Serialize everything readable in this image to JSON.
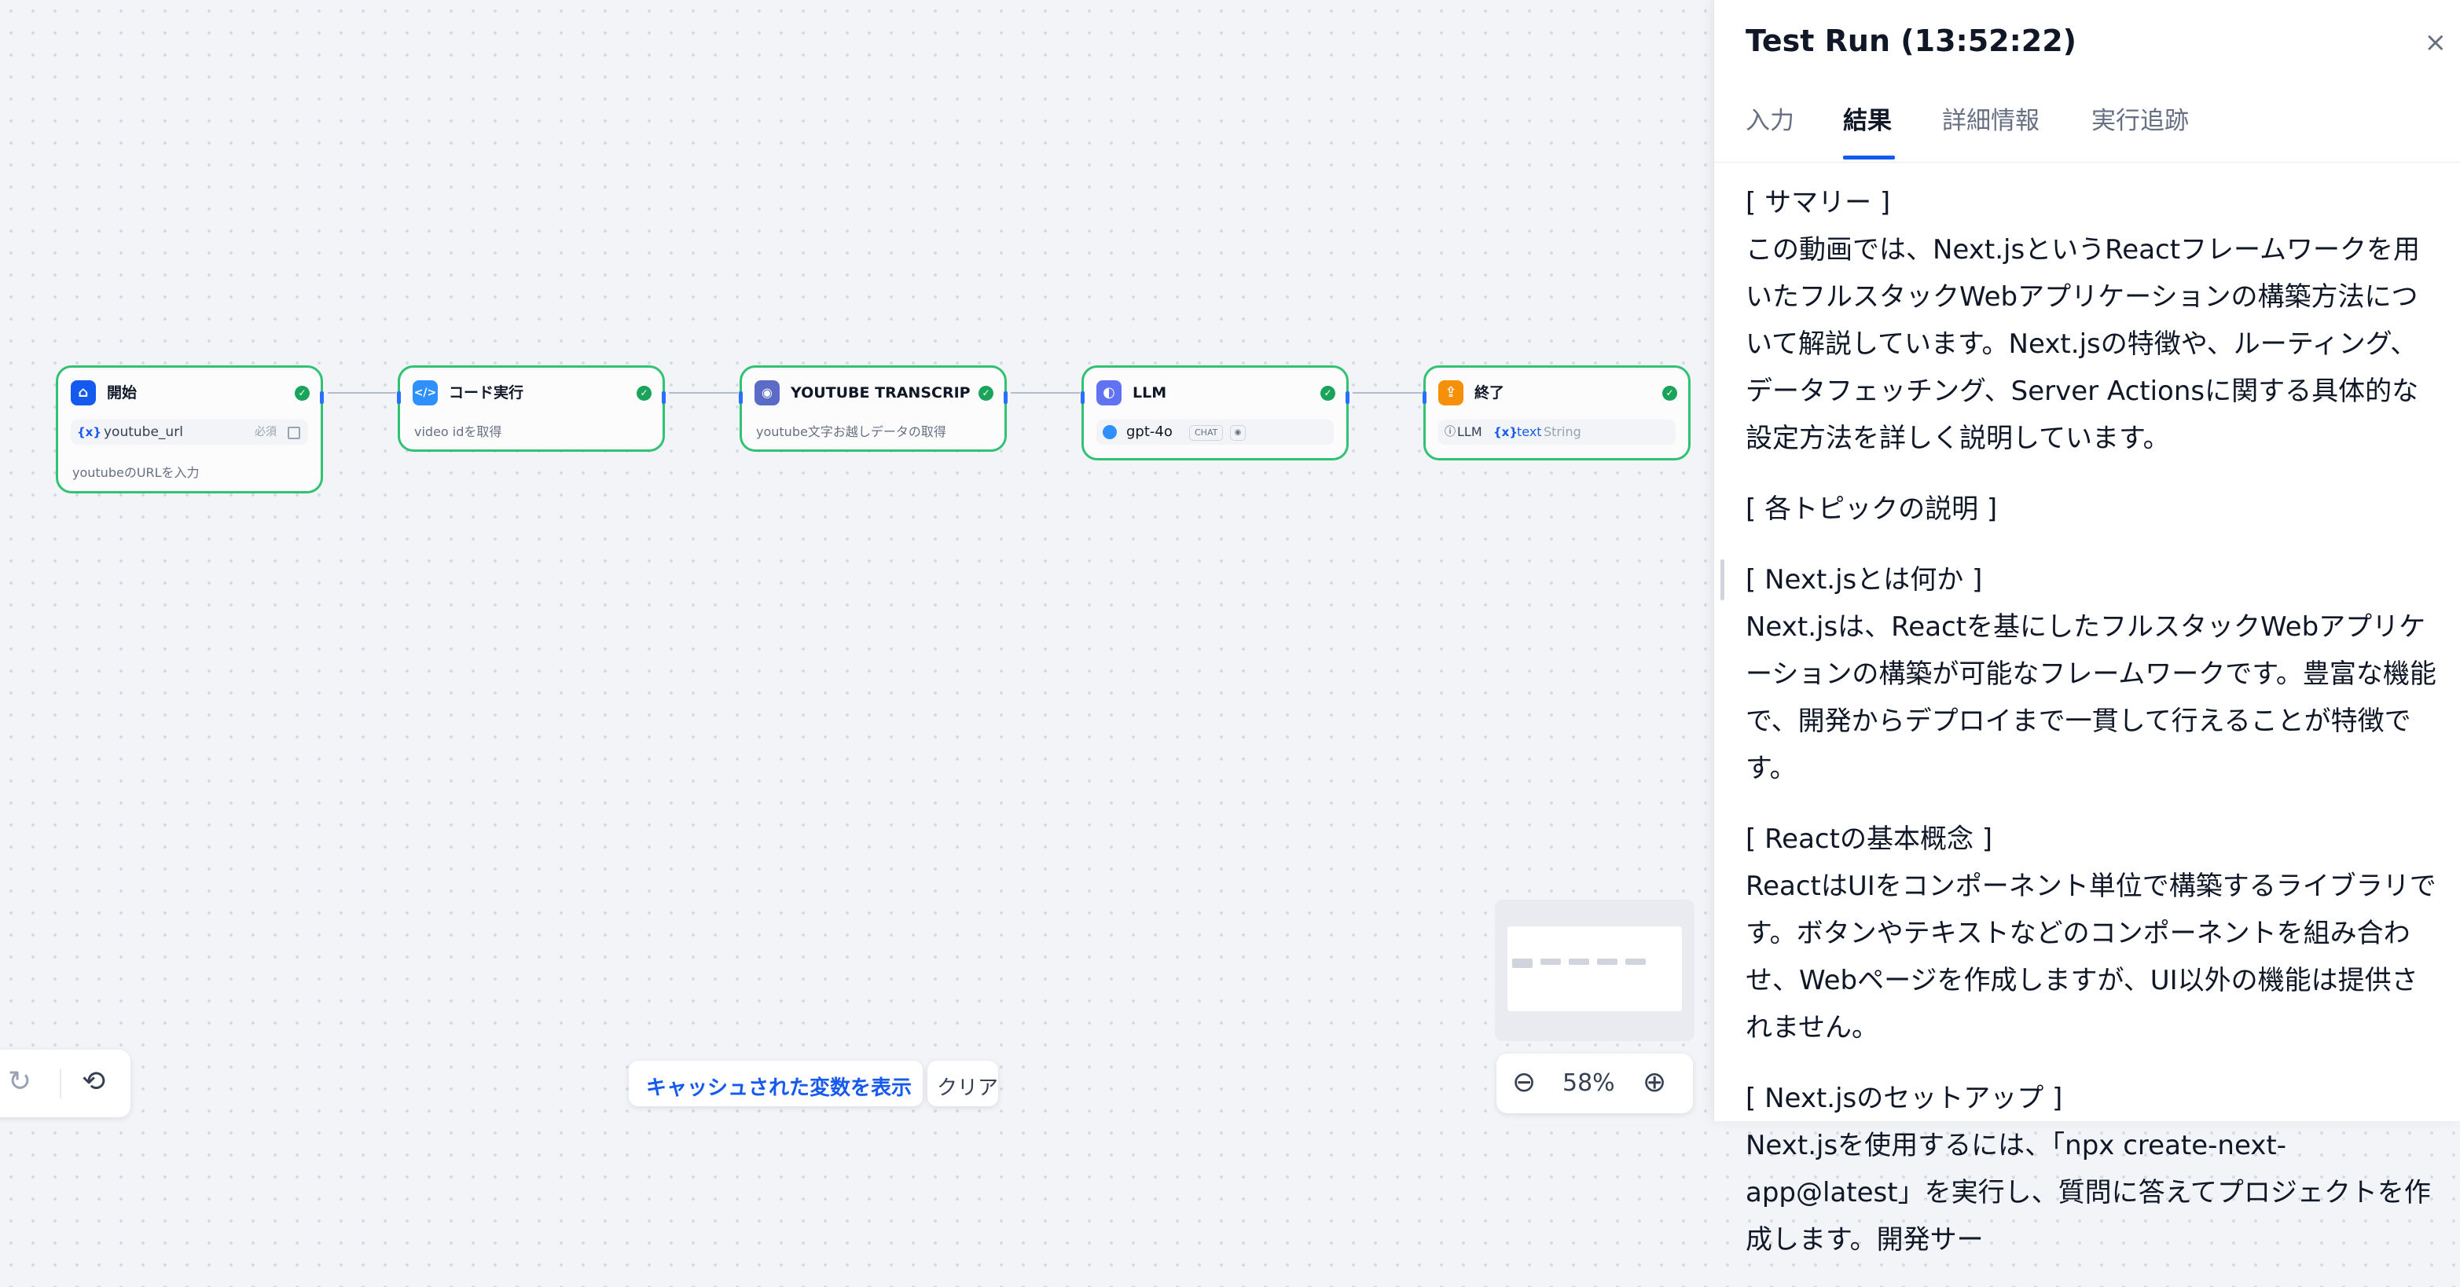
{
  "workflow": {
    "nodes": [
      {
        "title": "開始",
        "icon": "home-icon",
        "variable": "youtube_url",
        "required": "必須",
        "description": "youtubeのURLを入力"
      },
      {
        "title": "コード実行",
        "icon": "code-icon",
        "description": "video idを取得"
      },
      {
        "title": "YOUTUBE TRANSCRIPTS API",
        "icon": "plugin-icon",
        "description": "youtube文字お越しデータの取得"
      },
      {
        "title": "LLM",
        "icon": "brain-icon",
        "model": "gpt-4o",
        "model_mode": "CHAT"
      },
      {
        "title": "終了",
        "icon": "output-icon",
        "output_source": "LLM",
        "output_var": "text",
        "output_type": "String"
      }
    ]
  },
  "canvas_toolbar": {
    "show_cached_label": "キャッシュされた変数を表示",
    "clear_label": "クリア",
    "zoom": "58%"
  },
  "panel": {
    "title": "Test Run (13:52:22)",
    "close": "×",
    "tabs": [
      "入力",
      "結果",
      "詳細情報",
      "実行追跡"
    ],
    "active_tab": "結果",
    "result": {
      "summary_heading": "[ サマリー ]",
      "summary_text": "この動画では、Next.jsというReactフレームワークを用いたフルスタックWebアプリケーションの構築方法について解説しています。Next.jsの特徴や、ルーティング、データフェッチング、Server Actionsに関する具体的な設定方法を詳しく説明しています。",
      "topics_heading": "[ 各トピックの説明 ]",
      "t1_heading": "[ Next.jsとは何か ]",
      "t1_text": "Next.jsは、Reactを基にしたフルスタックWebアプリケーションの構築が可能なフレームワークです。豊富な機能で、開発からデプロイまで一貫して行えることが特徴です。",
      "t2_heading": "[ Reactの基本概念 ]",
      "t2_text": "ReactはUIをコンポーネント単位で構築するライブラリです。ボタンやテキストなどのコンポーネントを組み合わせ、Webページを作成しますが、UI以外の機能は提供されません。",
      "t3_heading": "[ Next.jsのセットアップ ]",
      "t3_text": "Next.jsを使用するには、「npx create-next-app@latest」を実行し、質問に答えてプロジェクトを作成します。開発サー"
    }
  }
}
